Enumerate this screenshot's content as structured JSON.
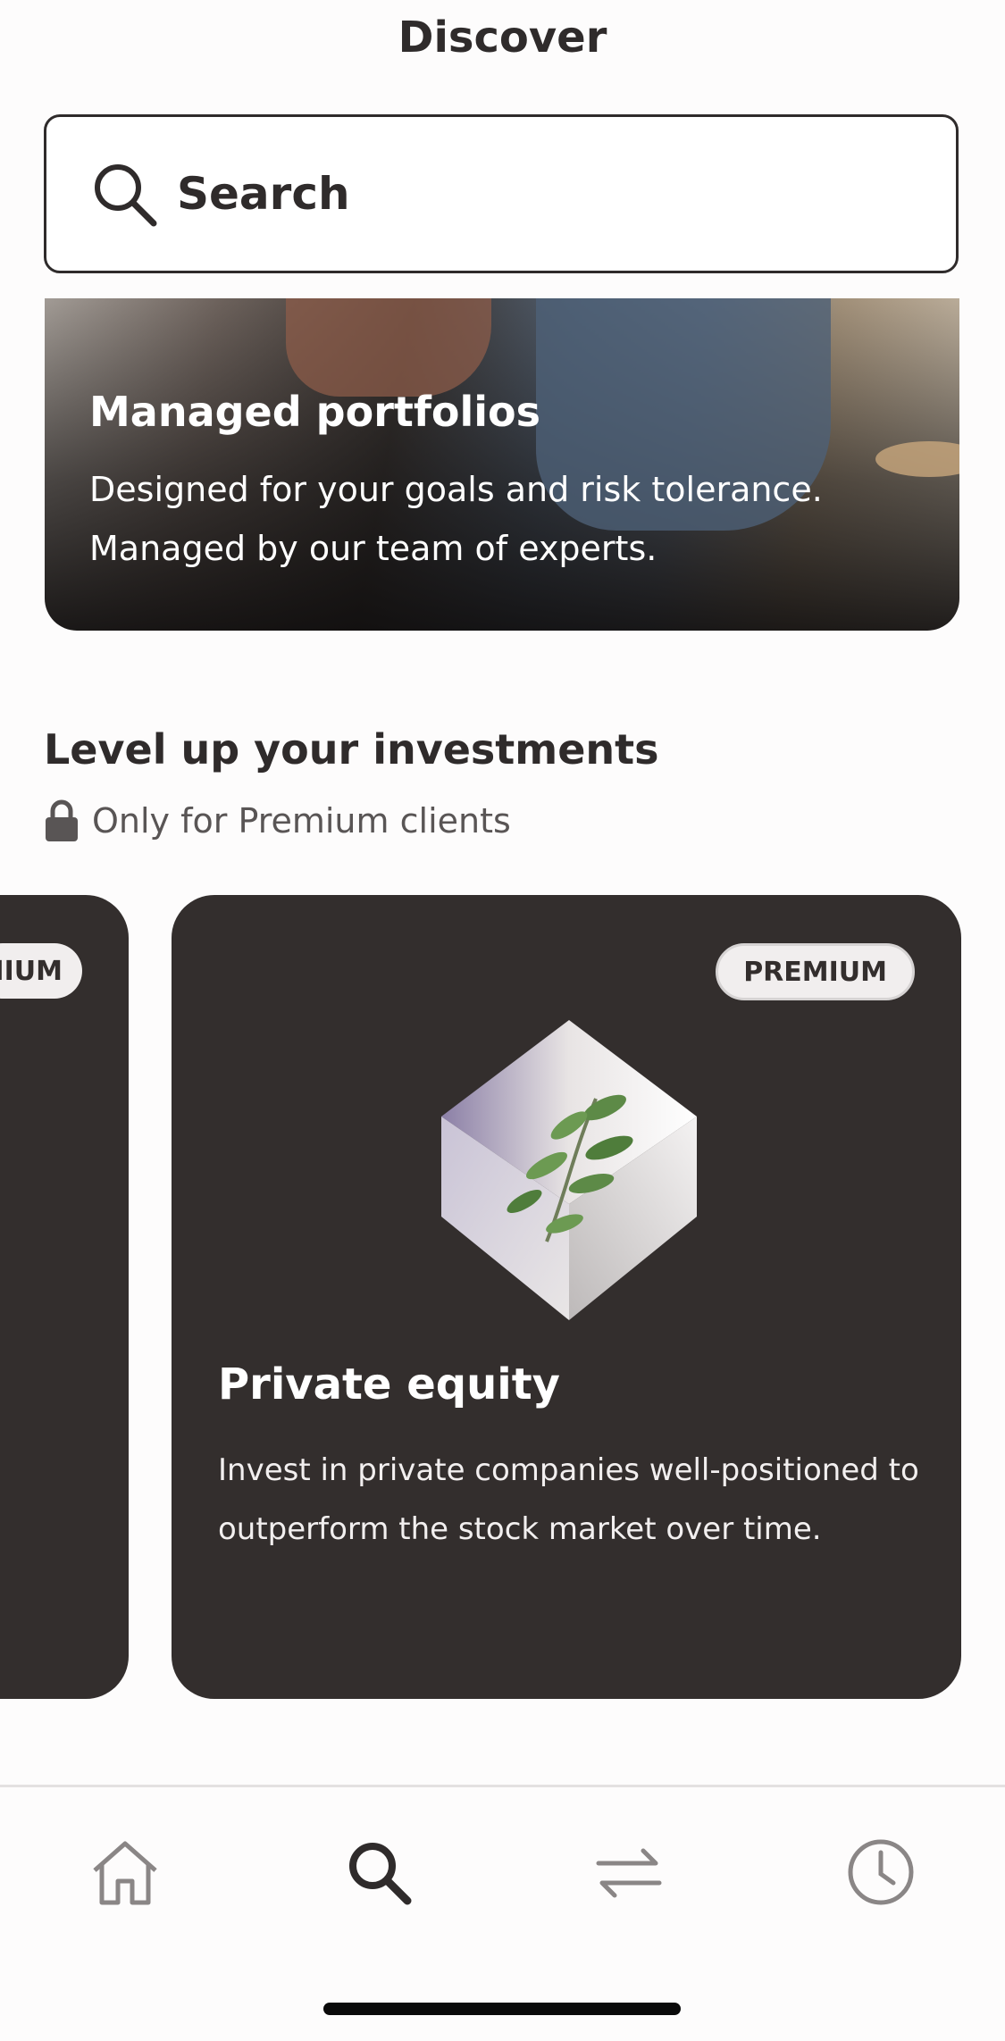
{
  "header": {
    "title": "Discover"
  },
  "search": {
    "label": "Search",
    "icon": "search-icon"
  },
  "hero": {
    "title": "Managed portfolios",
    "description_line1": "Designed for your goals and risk tolerance.",
    "description_line2": "Managed by our team of experts."
  },
  "section": {
    "title": "Level up your investments",
    "subtitle": "Only for Premium clients",
    "icon": "lock-icon"
  },
  "cards": [
    {
      "badge": "PREMIUM"
    },
    {
      "badge": "PREMIUM",
      "title": "Private equity",
      "description_line1": "Invest in private companies well-positioned to",
      "description_line2": "outperform the stock market over time.",
      "image": "cube-plant-image"
    }
  ],
  "tabbar": {
    "items": [
      {
        "icon": "home-icon",
        "active": false
      },
      {
        "icon": "search-icon",
        "active": true
      },
      {
        "icon": "transfer-arrows-icon",
        "active": false
      },
      {
        "icon": "clock-icon",
        "active": false
      }
    ]
  },
  "colors": {
    "background": "#fdfcfc",
    "text": "#2f2b2b",
    "card": "#332e2d",
    "badge": "#f1eeee",
    "inactive_icon": "#8a8686"
  }
}
